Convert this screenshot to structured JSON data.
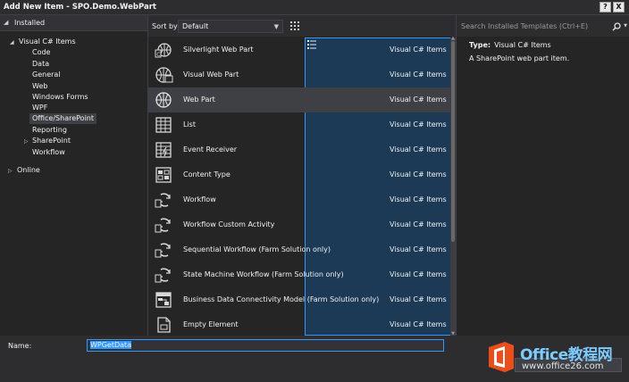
{
  "window": {
    "title": "Add New Item - SPO.Demo.WebPart",
    "help_label": "?",
    "close_label": "X"
  },
  "tree": {
    "installed_label": "Installed",
    "root_label": "Visual C# Items",
    "children": [
      "Code",
      "Data",
      "General",
      "Web",
      "Windows Forms",
      "WPF",
      "Office/SharePoint",
      "Reporting",
      "SharePoint",
      "Workflow"
    ],
    "selected": "Office/SharePoint",
    "online_label": "Online"
  },
  "sortbar": {
    "label": "Sort by:",
    "value": "Default"
  },
  "templates": [
    {
      "name": "Silverlight Web Part",
      "category": "Visual C# Items",
      "icon": "silverlight-webpart-icon"
    },
    {
      "name": "Visual Web Part",
      "category": "Visual C# Items",
      "icon": "visual-webpart-icon"
    },
    {
      "name": "Web Part",
      "category": "Visual C# Items",
      "icon": "webpart-globe-icon"
    },
    {
      "name": "List",
      "category": "Visual C# Items",
      "icon": "list-grid-icon"
    },
    {
      "name": "Event Receiver",
      "category": "Visual C# Items",
      "icon": "event-receiver-icon"
    },
    {
      "name": "Content Type",
      "category": "Visual C# Items",
      "icon": "content-type-icon"
    },
    {
      "name": "Workflow",
      "category": "Visual C# Items",
      "icon": "workflow-icon"
    },
    {
      "name": "Workflow Custom Activity",
      "category": "Visual C# Items",
      "icon": "workflow-activity-icon"
    },
    {
      "name": "Sequential Workflow (Farm Solution only)",
      "category": "Visual C# Items",
      "icon": "sequential-workflow-icon"
    },
    {
      "name": "State Machine Workflow (Farm Solution only)",
      "category": "Visual C# Items",
      "icon": "state-machine-workflow-icon"
    },
    {
      "name": "Business Data Connectivity Model (Farm Solution only)",
      "category": "Visual C# Items",
      "icon": "bdc-model-icon"
    },
    {
      "name": "Empty Element",
      "category": "Visual C# Items",
      "icon": "empty-element-icon"
    }
  ],
  "selected_template": "Web Part",
  "search": {
    "placeholder": "Search Installed Templates (Ctrl+E)"
  },
  "details": {
    "type_label": "Type:",
    "type_value": "Visual C# Items",
    "description": "A SharePoint web part item."
  },
  "name_field": {
    "label": "Name:",
    "value": "WPGetData"
  },
  "watermark": {
    "brand": "Office教程网",
    "url": "www.office26.com"
  },
  "colors": {
    "accent": "#3399ff",
    "background": "#2d2d30",
    "panel": "#252526",
    "selection": "#3f3f46"
  }
}
